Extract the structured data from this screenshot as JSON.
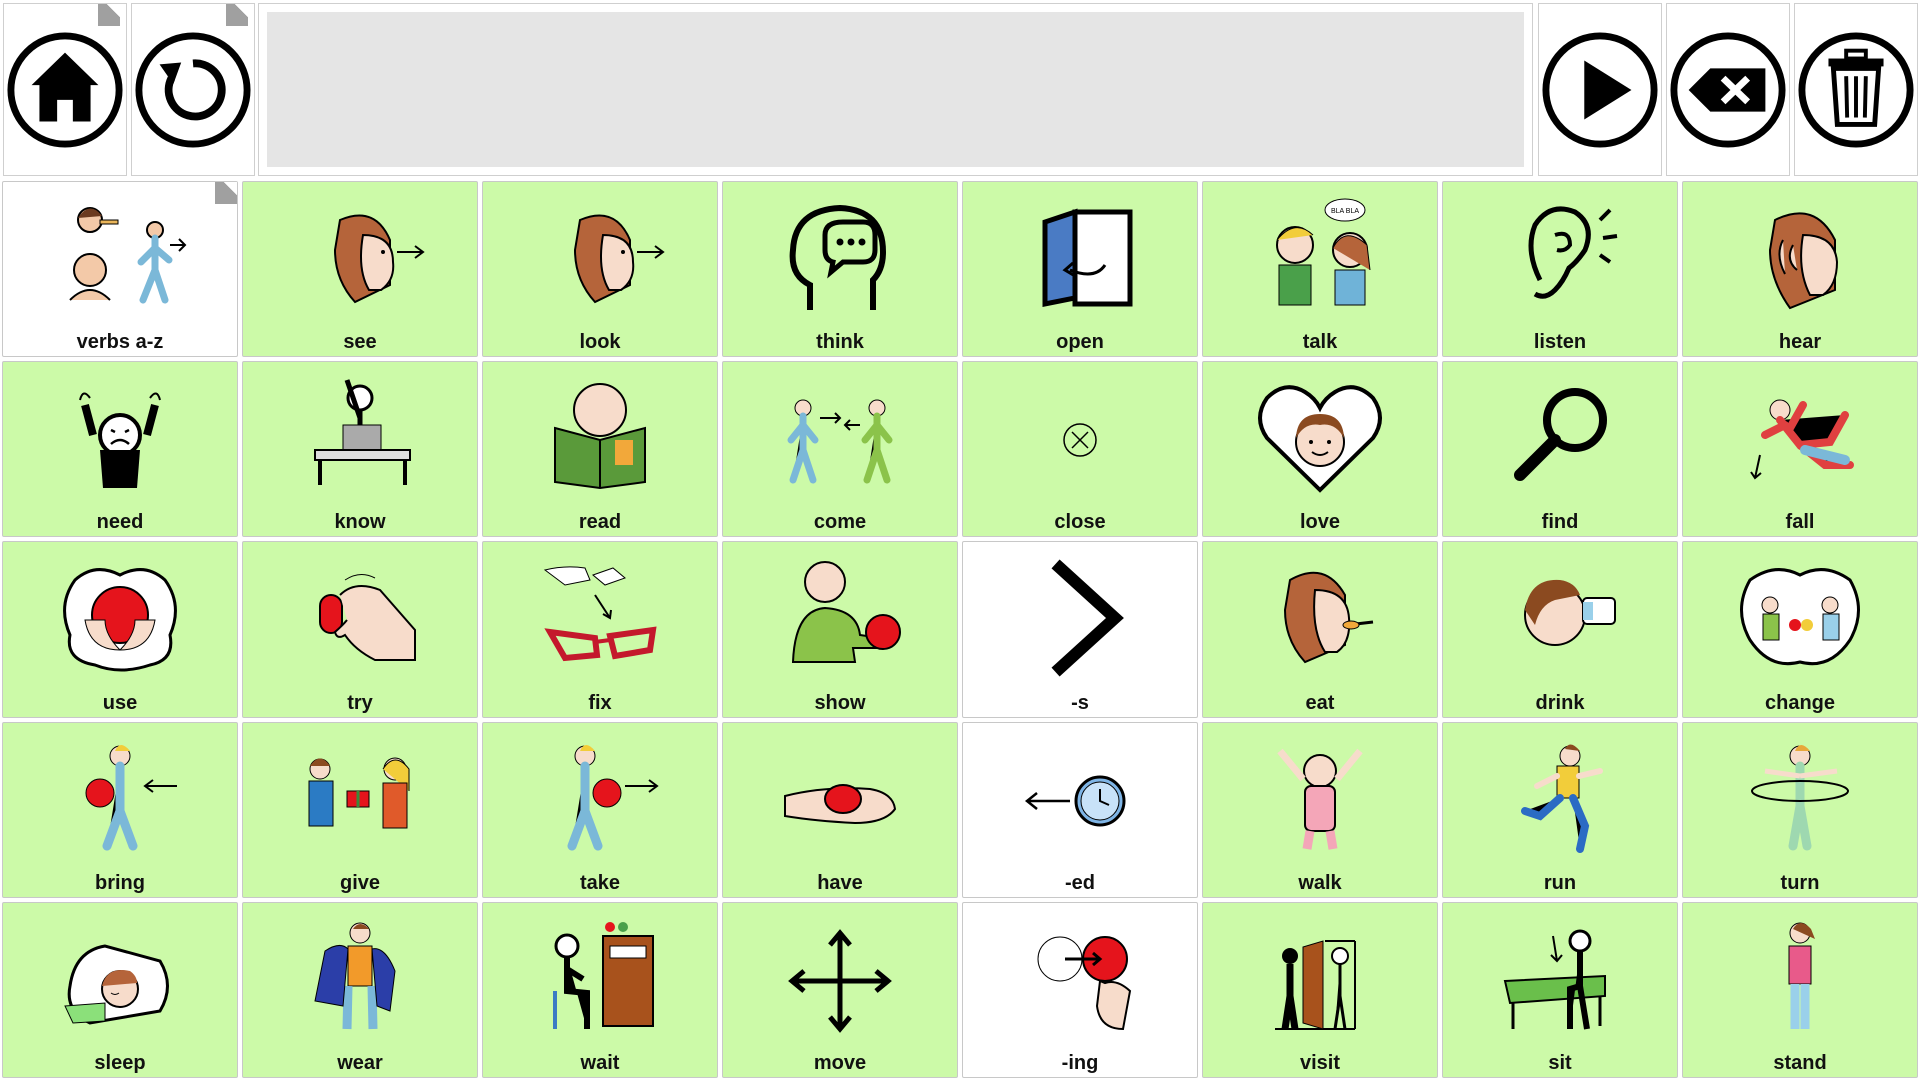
{
  "toolbar": {
    "home_icon": "home-icon",
    "undo_icon": "undo-icon",
    "speak_icon": "play-icon",
    "backspace_icon": "backspace-icon",
    "clear_icon": "trash-icon"
  },
  "message_bar": {
    "text": ""
  },
  "colors": {
    "green_cell": "#ccfaa8",
    "white_cell": "#ffffff",
    "accent_red": "#e5141c"
  },
  "cells": [
    {
      "label": "verbs a-z",
      "bg": "white",
      "icon": "eat-walk-folder-icon"
    },
    {
      "label": "see",
      "bg": "green",
      "icon": "see-icon"
    },
    {
      "label": "look",
      "bg": "green",
      "icon": "look-icon"
    },
    {
      "label": "think",
      "bg": "green",
      "icon": "think-icon"
    },
    {
      "label": "open",
      "bg": "green",
      "icon": "open-door-icon"
    },
    {
      "label": "talk",
      "bg": "green",
      "icon": "talk-icon"
    },
    {
      "label": "listen",
      "bg": "green",
      "icon": "ear-icon"
    },
    {
      "label": "hear",
      "bg": "green",
      "icon": "hear-icon"
    },
    {
      "label": "need",
      "bg": "green",
      "icon": "need-icon"
    },
    {
      "label": "know",
      "bg": "green",
      "icon": "know-icon"
    },
    {
      "label": "read",
      "bg": "green",
      "icon": "read-book-icon"
    },
    {
      "label": "come",
      "bg": "green",
      "icon": "come-icon"
    },
    {
      "label": "close",
      "bg": "green",
      "icon": "close-circle-icon"
    },
    {
      "label": "love",
      "bg": "green",
      "icon": "heart-icon"
    },
    {
      "label": "find",
      "bg": "green",
      "icon": "magnifier-icon"
    },
    {
      "label": "fall",
      "bg": "green",
      "icon": "fall-icon"
    },
    {
      "label": "use",
      "bg": "green",
      "icon": "use-ball-icon"
    },
    {
      "label": "try",
      "bg": "green",
      "icon": "try-hand-icon"
    },
    {
      "label": "fix",
      "bg": "green",
      "icon": "glasses-icon"
    },
    {
      "label": "show",
      "bg": "green",
      "icon": "show-icon"
    },
    {
      "label": "-s",
      "bg": "white",
      "icon": "chevron-right-icon"
    },
    {
      "label": "eat",
      "bg": "green",
      "icon": "eat-icon"
    },
    {
      "label": "drink",
      "bg": "green",
      "icon": "drink-icon"
    },
    {
      "label": "change",
      "bg": "green",
      "icon": "change-icon"
    },
    {
      "label": "bring",
      "bg": "green",
      "icon": "bring-icon"
    },
    {
      "label": "give",
      "bg": "green",
      "icon": "give-icon"
    },
    {
      "label": "take",
      "bg": "green",
      "icon": "take-icon"
    },
    {
      "label": "have",
      "bg": "green",
      "icon": "have-hand-icon"
    },
    {
      "label": "-ed",
      "bg": "white",
      "icon": "clock-arrow-icon"
    },
    {
      "label": "walk",
      "bg": "green",
      "icon": "baby-walk-icon"
    },
    {
      "label": "run",
      "bg": "green",
      "icon": "run-icon"
    },
    {
      "label": "turn",
      "bg": "green",
      "icon": "turn-icon"
    },
    {
      "label": "sleep",
      "bg": "green",
      "icon": "sleep-icon"
    },
    {
      "label": "wear",
      "bg": "green",
      "icon": "wear-icon"
    },
    {
      "label": "wait",
      "bg": "green",
      "icon": "wait-icon"
    },
    {
      "label": "move",
      "bg": "green",
      "icon": "move-arrows-icon"
    },
    {
      "label": "-ing",
      "bg": "white",
      "icon": "push-ball-icon"
    },
    {
      "label": "visit",
      "bg": "green",
      "icon": "visit-icon"
    },
    {
      "label": "sit",
      "bg": "green",
      "icon": "sit-bench-icon"
    },
    {
      "label": "stand",
      "bg": "green",
      "icon": "stand-icon"
    }
  ]
}
